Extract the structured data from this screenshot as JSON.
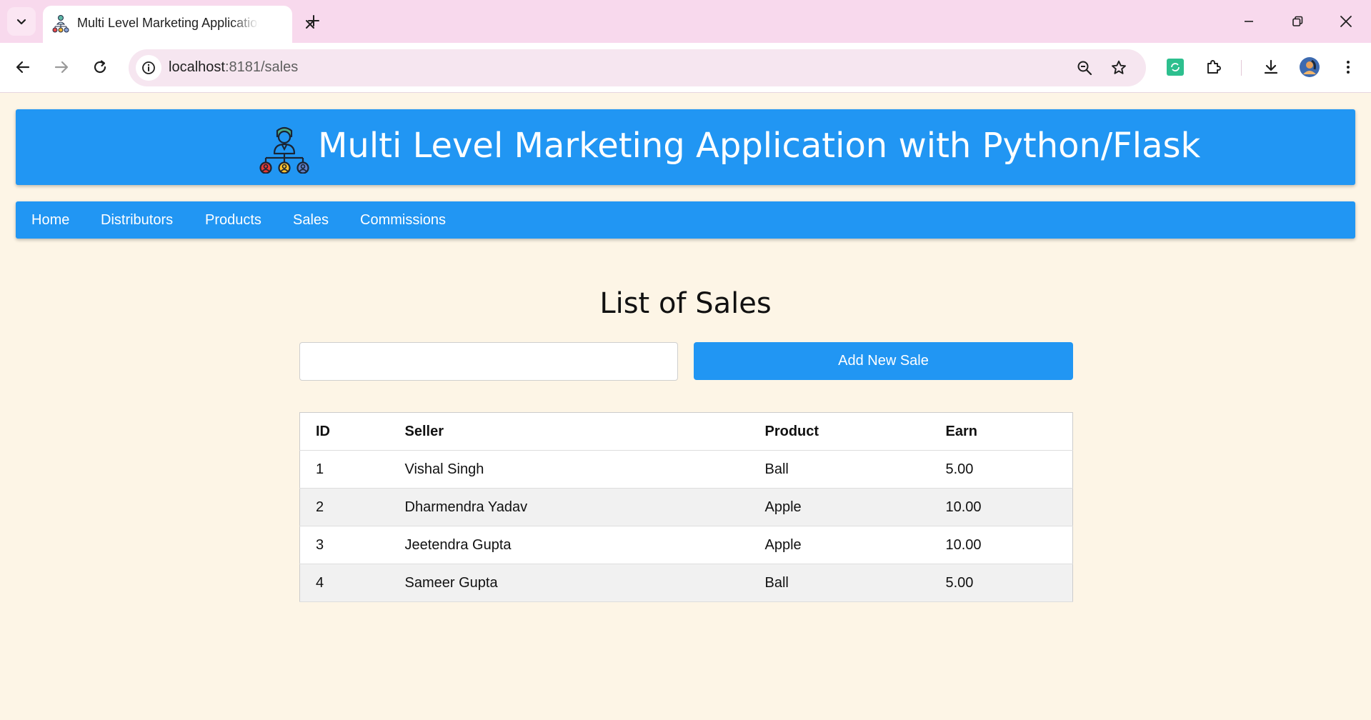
{
  "browser": {
    "tab_title": "Multi Level Marketing Application with Python/Flask",
    "url_host": "localhost",
    "url_rest": ":8181/sales"
  },
  "header": {
    "title": "Multi Level Marketing Application with Python/Flask"
  },
  "nav": {
    "items": [
      {
        "label": "Home"
      },
      {
        "label": "Distributors"
      },
      {
        "label": "Products"
      },
      {
        "label": "Sales"
      },
      {
        "label": "Commissions"
      }
    ]
  },
  "main": {
    "title": "List of Sales",
    "search_value": "",
    "search_placeholder": "",
    "add_button_label": "Add New Sale",
    "table": {
      "columns": [
        "ID",
        "Seller",
        "Product",
        "Earn"
      ],
      "rows": [
        [
          "1",
          "Vishal Singh",
          "Ball",
          "5.00"
        ],
        [
          "2",
          "Dharmendra Yadav",
          "Apple",
          "10.00"
        ],
        [
          "3",
          "Jeetendra Gupta",
          "Apple",
          "10.00"
        ],
        [
          "4",
          "Sameer Gupta",
          "Ball",
          "5.00"
        ]
      ]
    }
  },
  "colors": {
    "accent": "#2196f3",
    "page_background": "#fdf5e6",
    "tabbar_background": "#f8d9ed"
  }
}
